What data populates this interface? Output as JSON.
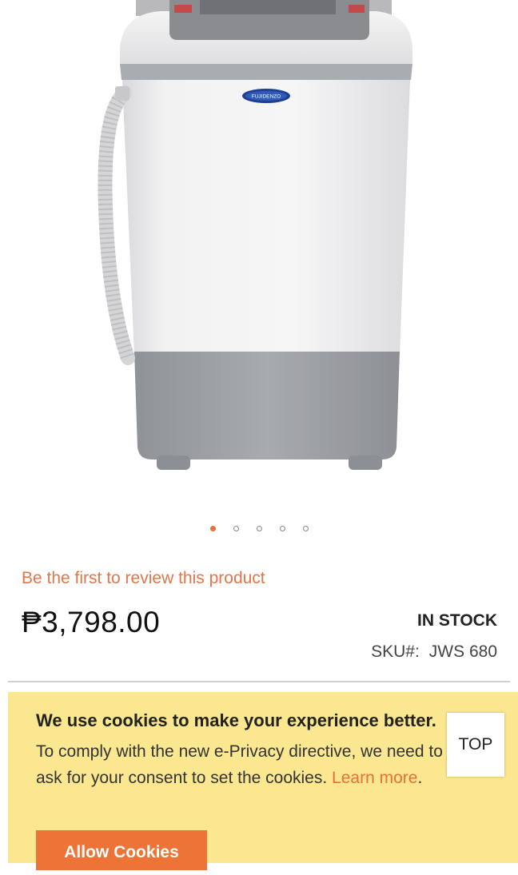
{
  "product_image": {
    "brand_badge": "FUJIDENZO"
  },
  "gallery": {
    "image_count": 5,
    "active_index": 0
  },
  "review": {
    "link_text": "Be the first to review this product"
  },
  "price": {
    "amount": "₱3,798.00"
  },
  "stock": {
    "status": "IN STOCK"
  },
  "sku": {
    "label": "SKU#:",
    "value": "JWS 680"
  },
  "cookie_banner": {
    "title": "We use cookies to make your experience better.",
    "text": "To comply with the new e-Privacy directive, we need to ask for your consent to set the cookies.",
    "learn_more": "Learn more",
    "period": ".",
    "allow_button": "Allow Cookies"
  },
  "top_button": {
    "label": "TOP"
  },
  "colors": {
    "accent": "#e8703a",
    "banner": "#fbe78f"
  }
}
